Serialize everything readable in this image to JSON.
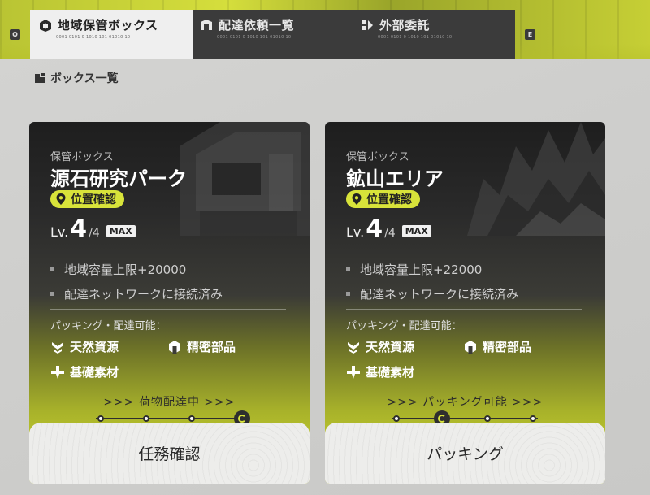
{
  "tabs": {
    "key_left": "Q",
    "key_right": "E",
    "items": [
      {
        "label": "地域保管ボックス",
        "sub": "0001 0101 0 1010 101 01010 10",
        "icon": "box-icon",
        "active": true
      },
      {
        "label": "配達依頼一覧",
        "sub": "0001 0101 0 1010 101 01010 10",
        "icon": "delivery-icon",
        "active": false
      },
      {
        "label": "外部委託",
        "sub": "0001 0101 0 1010 101 01010 10",
        "icon": "outsource-icon",
        "active": false
      }
    ]
  },
  "section": {
    "title": "ボックス一覧",
    "icon": "list-icon"
  },
  "cards": [
    {
      "kind": "保管ボックス",
      "name": "源石研究パーク",
      "location_btn": "位置確認",
      "level_prefix": "Lv.",
      "level": "4",
      "level_max": "/4",
      "max_badge": "MAX",
      "stats": [
        "地域容量上限+20000",
        "配達ネットワークに接続済み"
      ],
      "packing_label": "パッキング・配達可能：",
      "resources": [
        {
          "icon": "natural-resource-icon",
          "label": "天然資源"
        },
        {
          "icon": "precision-part-icon",
          "label": "精密部品"
        },
        {
          "icon": "basic-material-icon",
          "label": "基礎素材"
        }
      ],
      "status": ">>> 荷物配達中 >>>",
      "progress_step": 4,
      "progress_total": 4,
      "action": "任務確認"
    },
    {
      "kind": "保管ボックス",
      "name": "鉱山エリア",
      "location_btn": "位置確認",
      "level_prefix": "Lv.",
      "level": "4",
      "level_max": "/4",
      "max_badge": "MAX",
      "stats": [
        "地域容量上限+22000",
        "配達ネットワークに接続済み"
      ],
      "packing_label": "パッキング・配達可能：",
      "resources": [
        {
          "icon": "natural-resource-icon",
          "label": "天然資源"
        },
        {
          "icon": "precision-part-icon",
          "label": "精密部品"
        },
        {
          "icon": "basic-material-icon",
          "label": "基礎素材"
        }
      ],
      "status": ">>> パッキング可能 >>>",
      "progress_step": 2,
      "progress_total": 4,
      "action": "パッキング"
    }
  ],
  "colors": {
    "accent": "#d8e33a",
    "dark": "#2e2e2e"
  }
}
